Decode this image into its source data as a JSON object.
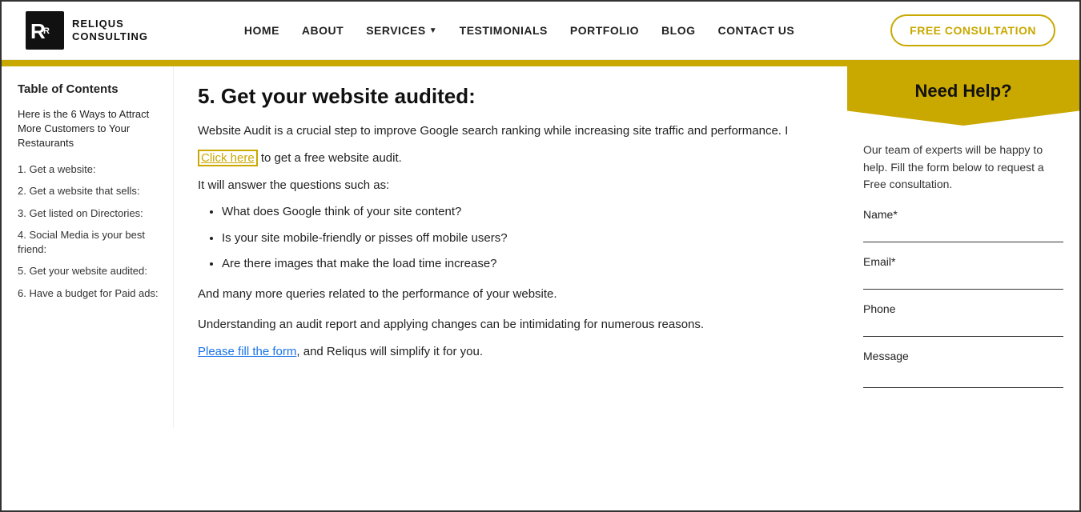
{
  "header": {
    "logo_line1": "RELIQUS",
    "logo_line2": "CONSULTING",
    "nav_items": [
      {
        "label": "HOME",
        "id": "home"
      },
      {
        "label": "ABOUT",
        "id": "about"
      },
      {
        "label": "SERVICES",
        "id": "services",
        "has_dropdown": true
      },
      {
        "label": "TESTIMONIALS",
        "id": "testimonials"
      },
      {
        "label": "PORTFOLIO",
        "id": "portfolio"
      },
      {
        "label": "BLOG",
        "id": "blog"
      },
      {
        "label": "CONTACT US",
        "id": "contact"
      }
    ],
    "cta_label": "FREE CONSULTATION"
  },
  "sidebar": {
    "toc_title": "Table of Contents",
    "toc_intro": "Here is the 6 Ways to Attract More Customers to Your Restaurants",
    "items": [
      {
        "label": "1. Get a website:"
      },
      {
        "label": "2. Get a website that sells:"
      },
      {
        "label": "3. Get listed on Directories:"
      },
      {
        "label": "4. Social Media is your best friend:"
      },
      {
        "label": "5. Get your website audited:"
      },
      {
        "label": "6. Have a budget for Paid ads:"
      }
    ]
  },
  "main": {
    "section_title": "5. Get your website audited:",
    "intro_text": "Website Audit is a crucial step to improve Google search ranking while increasing site traffic and performance. I",
    "click_here_label": "Click here",
    "click_here_suffix": " to get a free website audit.",
    "it_will_text": "It will answer the questions such as:",
    "bullets": [
      "What does Google think of your site content?",
      "Is your site mobile-friendly or pisses off mobile users?",
      "Are there images that make the load time increase?"
    ],
    "many_more_text": "And many more queries related to the performance of your website.",
    "understanding_text": "Understanding an audit report and applying changes can be intimidating for numerous reasons.",
    "please_prefix": "Please",
    "please_link_text": " fill the form",
    "please_suffix": ", and Reliqus will simplify it for you."
  },
  "sidebar_right": {
    "header": "Need Help?",
    "description": "Our team of experts will be happy to help. Fill the form below to request a Free consultation.",
    "name_label": "Name*",
    "email_label": "Email*",
    "phone_label": "Phone",
    "message_label": "Message",
    "name_placeholder": "",
    "email_placeholder": "",
    "phone_placeholder": "",
    "message_placeholder": ""
  },
  "colors": {
    "gold": "#c9a800",
    "link_blue": "#1a73e8"
  }
}
